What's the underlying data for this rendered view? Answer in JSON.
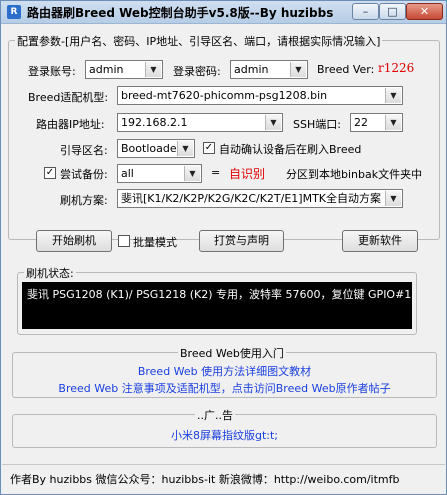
{
  "window": {
    "title": "路由器刷Breed Web控制台助手v5.8版--By huzibbs",
    "min_label": "–",
    "max_label": "□",
    "close_label": "✕"
  },
  "config": {
    "legend": "配置参数-[用户名、密码、IP地址、引导区名、端口，请根据实际情况输入]",
    "username_label": "登录账号:",
    "username_value": "admin",
    "password_label": "登录密码:",
    "password_value": "admin",
    "breed_ver_label": "Breed Ver:",
    "breed_ver_value": "r1226",
    "model_label": "Breed适配机型:",
    "model_value": "breed-mt7620-phicomm-psg1208.bin",
    "ip_label": "路由器IP地址:",
    "ip_value": "192.168.2.1",
    "ssh_label": "SSH端口:",
    "ssh_value": "22",
    "boot_label": "引导区名:",
    "boot_value": "Bootloader",
    "auto_confirm_label": "自动确认设备后在刷入Breed",
    "auto_confirm_checked": true,
    "backup_label": "尝试备份:",
    "backup_checked": true,
    "backup_value": "all",
    "equals": "=",
    "auto_detect": "自识别",
    "partition_note": "分区到本地binbak文件夹中",
    "scheme_label": "刷机方案:",
    "scheme_value": "斐讯[K1/K2/K2P/K2G/K2C/K2T/E1]MTK全自动方案"
  },
  "actions": {
    "start_flash": "开始刷机",
    "batch_mode": "批量模式",
    "batch_checked": false,
    "reward": "打赏与声明",
    "update": "更新软件"
  },
  "status": {
    "legend": "刷机状态:",
    "console_text": "斐讯 PSG1208 (K1)/ PSG1218 (K2) 专用，波特率 57600，复位键 GPIO#1"
  },
  "guide": {
    "legend": "Breed Web使用入门",
    "link1": "Breed Web 使用方法详细图文教材",
    "link2": "Breed Web 注意事项及适配机型，点击访问Breed Web原作者帖子"
  },
  "ad": {
    "legend": "..广..告",
    "link": "小米8屏幕指纹版gt:t;"
  },
  "statusbar": {
    "text": "作者By huzibbs 微信公众号：huzibbs-it 新浪微博：http://weibo.com/itmfb"
  }
}
